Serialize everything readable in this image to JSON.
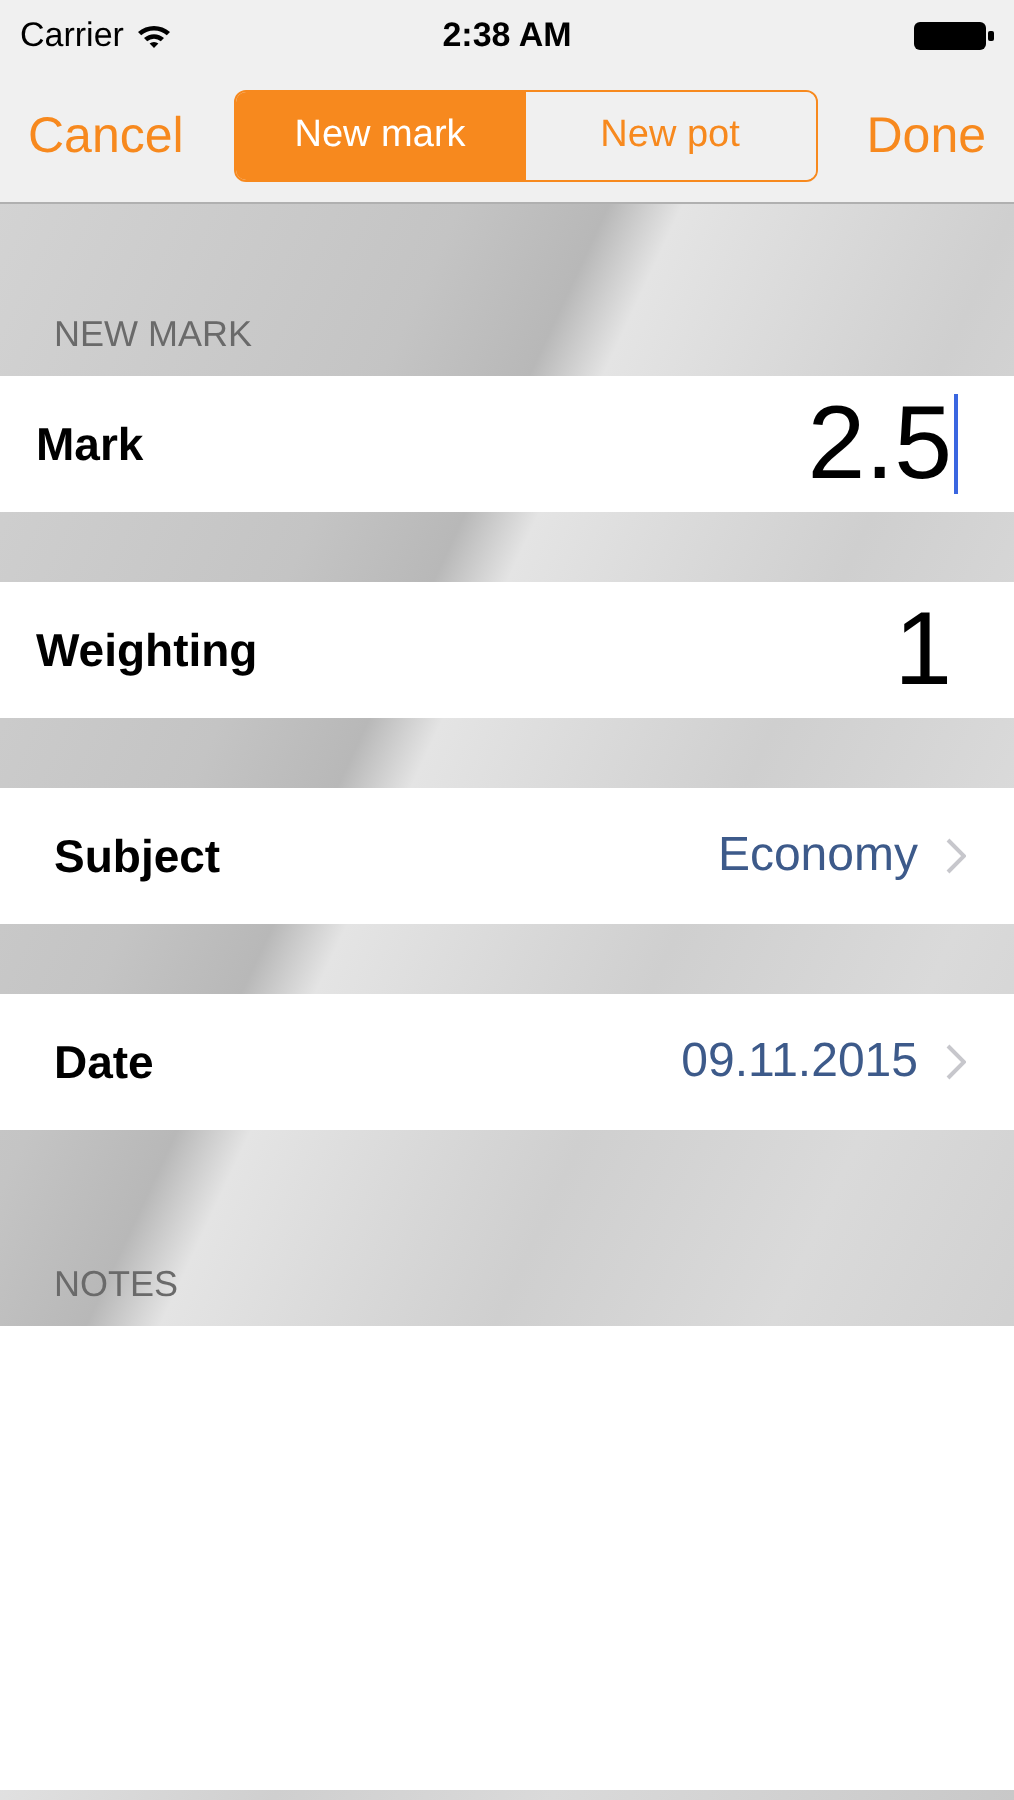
{
  "status_bar": {
    "carrier": "Carrier",
    "time": "2:38 AM"
  },
  "nav_bar": {
    "cancel": "Cancel",
    "done": "Done",
    "segments": [
      {
        "label": "New mark",
        "selected": true
      },
      {
        "label": "New pot",
        "selected": false
      }
    ]
  },
  "sections": [
    {
      "header": "NEW MARK",
      "rows": [
        {
          "kind": "input",
          "label": "Mark",
          "value": "2.5",
          "focused": true
        },
        {
          "kind": "input",
          "label": "Weighting",
          "value": "1",
          "focused": false
        },
        {
          "kind": "disclosure",
          "label": "Subject",
          "value": "Economy"
        },
        {
          "kind": "disclosure",
          "label": "Date",
          "value": "09.11.2015"
        }
      ]
    },
    {
      "header": "NOTES",
      "rows": [
        {
          "kind": "notes"
        }
      ]
    }
  ]
}
